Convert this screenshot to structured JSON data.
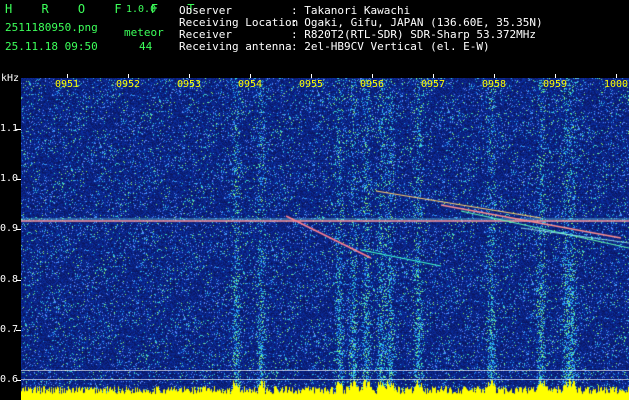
{
  "app": {
    "name": "H R O F F T",
    "version": "1.0.0",
    "filename": "2511180950.png",
    "datetime": "25.11.18 09:50",
    "meteor_label": "meteor",
    "meteor_count": "44"
  },
  "station": {
    "observer_label": "Observer",
    "observer_value": ": Takanori Kawachi",
    "location_label": "Receiving Location",
    "location_value": ": Ogaki, Gifu, JAPAN (136.60E, 35.35N)",
    "receiver_label": "Receiver",
    "receiver_value": ": R820T2(RTL-SDR) SDR-Sharp 53.372MHz",
    "antenna_label": "Receiving antenna",
    "antenna_value": ": 2el-HB9CV Vertical (el. E-W)"
  },
  "axis": {
    "y_unit": "kHz",
    "y_ticks": [
      "1.1",
      "1.0",
      "0.9",
      "0.8",
      "0.7",
      "0.6"
    ],
    "x_ticks": [
      "0951",
      "0952",
      "0953",
      "0954",
      "0955",
      "0956",
      "0957",
      "0958",
      "0959",
      "1000"
    ]
  },
  "colors": {
    "app_name": "#3cff5a",
    "time_labels": "#ffff00",
    "background_noise": "#0a1a7a",
    "carrier_line": "#ff8080",
    "power_bars": "#ffff00"
  }
}
